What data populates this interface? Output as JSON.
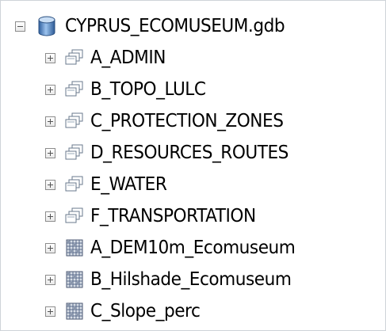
{
  "tree": {
    "root": {
      "label": "CYPRUS_ECOMUSEUM.gdb",
      "icon": "geodatabase-icon",
      "expanded": true
    },
    "items": [
      {
        "label": "A_ADMIN",
        "icon": "feature-dataset-icon"
      },
      {
        "label": "B_TOPO_LULC",
        "icon": "feature-dataset-icon"
      },
      {
        "label": "C_PROTECTION_ZONES",
        "icon": "feature-dataset-icon"
      },
      {
        "label": "D_RESOURCES_ROUTES",
        "icon": "feature-dataset-icon"
      },
      {
        "label": "E_WATER",
        "icon": "feature-dataset-icon"
      },
      {
        "label": "F_TRANSPORTATION",
        "icon": "feature-dataset-icon"
      },
      {
        "label": "A_DEM10m_Ecomuseum",
        "icon": "raster-dataset-icon"
      },
      {
        "label": "B_Hilshade_Ecomuseum",
        "icon": "raster-dataset-icon"
      },
      {
        "label": "C_Slope_perc",
        "icon": "raster-dataset-icon"
      }
    ]
  },
  "colors": {
    "database_blue": "#4f86c6",
    "raster_grid": "#5a6a8a",
    "dataset_outline": "#6a7a8c"
  }
}
